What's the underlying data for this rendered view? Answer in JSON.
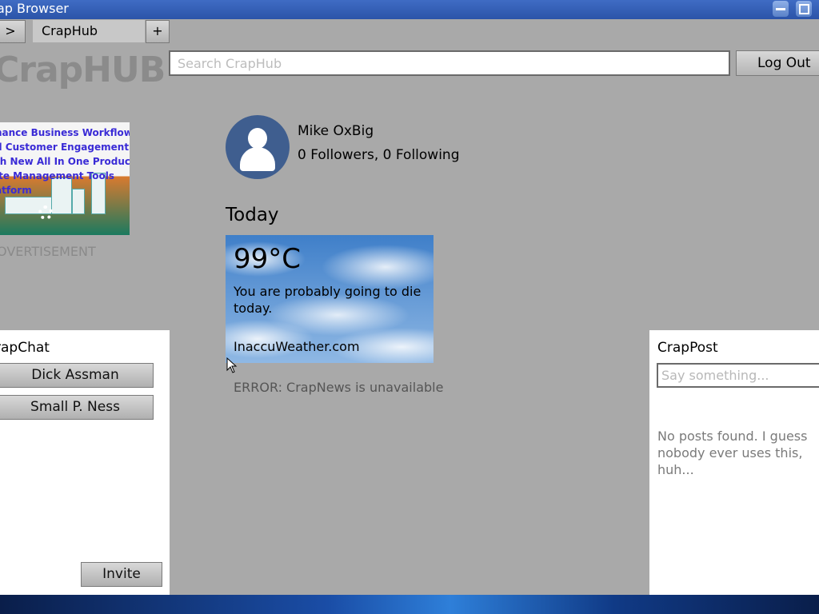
{
  "window": {
    "title": "ap Browser"
  },
  "tabs": {
    "back_label": ">",
    "active_tab": "CrapHub",
    "new_tab_label": "+"
  },
  "header": {
    "logo": "CrapHUB",
    "search_placeholder": "Search CrapHub",
    "logout_label": "Log Out"
  },
  "ad": {
    "lines": [
      "hance Business Workflows",
      "d Customer Engagement",
      "th New All In One Product",
      "ite Management Tools",
      "atform"
    ],
    "label": "OVERTISEMENT"
  },
  "profile": {
    "name": "Mike OxBig",
    "follow_stats": "0 Followers, 0 Following"
  },
  "today": {
    "heading": "Today",
    "weather": {
      "temperature": "99°C",
      "message": "You are probably going to die today.",
      "source": "InaccuWeather.com"
    },
    "news_error": "ERROR: CrapNews is unavailable"
  },
  "chat": {
    "title": "rapChat",
    "contacts": [
      "Dick Assman",
      "Small P. Ness"
    ],
    "invite_label": "Invite"
  },
  "post": {
    "title": "CrapPost",
    "input_placeholder": "Say something...",
    "empty_message": "No posts found. I guess nobody ever uses this, huh..."
  },
  "colors": {
    "page_bg": "#a9a9a9",
    "titlebar": "#2b54a8",
    "avatar_bg": "#3f5e8f"
  }
}
